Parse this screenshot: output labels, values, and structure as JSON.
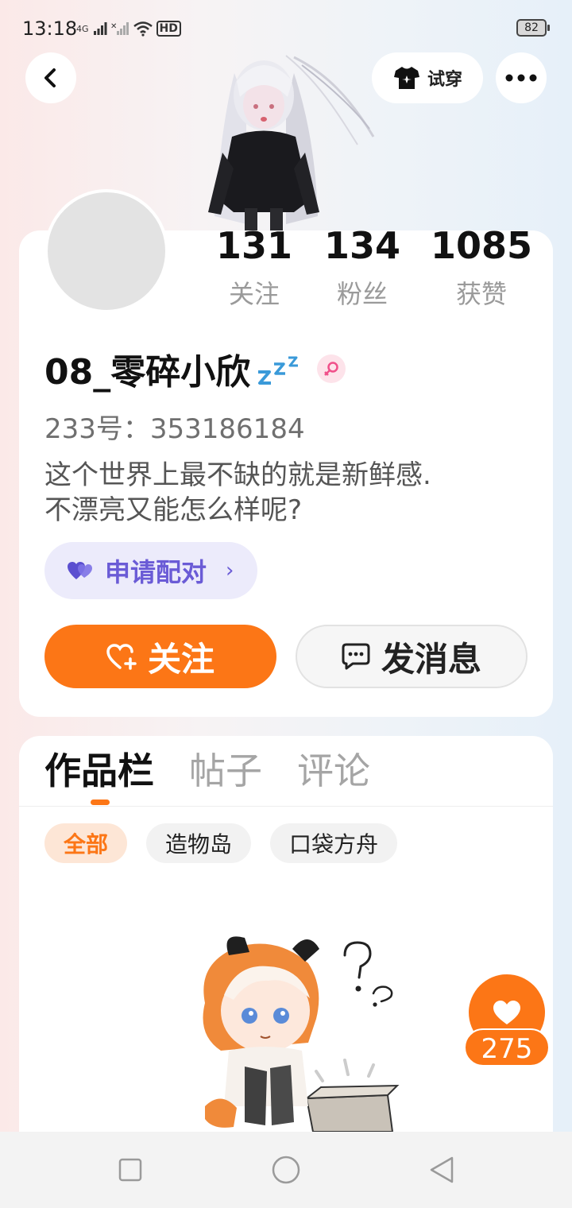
{
  "status_bar": {
    "time": "13:18",
    "network_label": "4G",
    "hd_label": "HD",
    "battery": "82"
  },
  "header": {
    "back_icon": "chevron-left-icon",
    "tryon_label": "试穿",
    "tryon_icon": "tshirt-icon",
    "more_icon": "more-dots-icon"
  },
  "profile": {
    "stats": [
      {
        "value": "131",
        "label": "关注"
      },
      {
        "value": "134",
        "label": "粉丝"
      },
      {
        "value": "1085",
        "label": "获赞"
      }
    ],
    "username": "08_零碎小欣",
    "uid": "233号：353186184",
    "bio_line1": "这个世界上最不缺的就是新鲜感.",
    "bio_line2": "不漂亮又能怎么样呢?",
    "pair_label": "申请配对",
    "pair_chevron": "›",
    "follow_label": "关注",
    "message_label": "发消息"
  },
  "tabs": [
    {
      "label": "作品栏",
      "active": true
    },
    {
      "label": "帖子",
      "active": false
    },
    {
      "label": "评论",
      "active": false
    }
  ],
  "chips": [
    {
      "label": "全部",
      "active": true
    },
    {
      "label": "造物岛",
      "active": false
    },
    {
      "label": "口袋方舟",
      "active": false
    }
  ],
  "like_float": {
    "count": "275",
    "icon": "heart-icon"
  },
  "colors": {
    "accent": "#fc7616",
    "pair": "#6a5bd6"
  }
}
